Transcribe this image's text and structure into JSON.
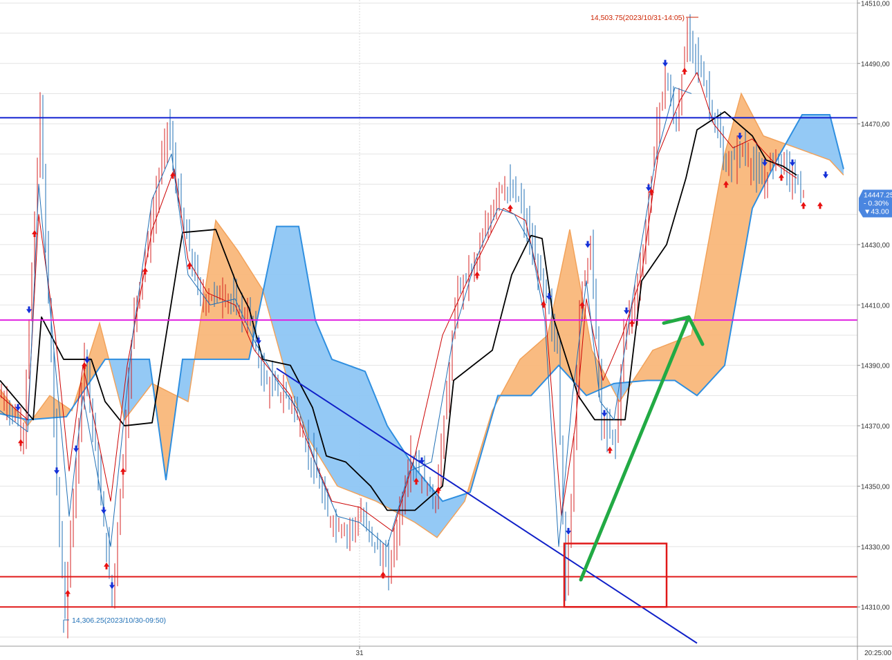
{
  "chart_data": {
    "type": "line",
    "title": "",
    "xlabel": "",
    "ylabel": "",
    "ylim": [
      14297,
      14511
    ],
    "y_ticks": [
      {
        "value": 14510,
        "label": "14510,00"
      },
      {
        "value": 14490,
        "label": "14490,00"
      },
      {
        "value": 14470,
        "label": "14470,00"
      },
      {
        "value": 14430,
        "label": "14430,00"
      },
      {
        "value": 14410,
        "label": "14410,00"
      },
      {
        "value": 14390,
        "label": "14390,00"
      },
      {
        "value": 14370,
        "label": "14370,00"
      },
      {
        "value": 14350,
        "label": "14350,00"
      },
      {
        "value": 14330,
        "label": "14330,00"
      },
      {
        "value": 14310,
        "label": "14310,00"
      }
    ],
    "y_ticks_minor": [
      14500,
      14480,
      14460,
      14450,
      14440,
      14420,
      14400,
      14380,
      14360,
      14340,
      14320,
      14300
    ],
    "x_labels": [
      {
        "index": 130,
        "label": "31"
      },
      {
        "index": 310,
        "label": "20:25:00"
      }
    ],
    "bar_count": 310,
    "price": {
      "keypoints": [
        [
          0,
          14380
        ],
        [
          8,
          14368
        ],
        [
          14,
          14474
        ],
        [
          20,
          14350
        ],
        [
          23,
          14307
        ],
        [
          30,
          14395
        ],
        [
          40,
          14312
        ],
        [
          48,
          14408
        ],
        [
          55,
          14440
        ],
        [
          60,
          14470
        ],
        [
          65,
          14440
        ],
        [
          72,
          14412
        ],
        [
          80,
          14414
        ],
        [
          90,
          14405
        ],
        [
          95,
          14385
        ],
        [
          105,
          14378
        ],
        [
          113,
          14356
        ],
        [
          118,
          14340
        ],
        [
          125,
          14335
        ],
        [
          130,
          14340
        ],
        [
          140,
          14322
        ],
        [
          148,
          14360
        ],
        [
          157,
          14345
        ],
        [
          165,
          14415
        ],
        [
          172,
          14425
        ],
        [
          180,
          14450
        ],
        [
          187,
          14445
        ],
        [
          193,
          14425
        ],
        [
          197,
          14412
        ],
        [
          201,
          14395
        ],
        [
          204,
          14315
        ],
        [
          206,
          14345
        ],
        [
          209,
          14410
        ],
        [
          213,
          14430
        ],
        [
          217,
          14370
        ],
        [
          222,
          14365
        ],
        [
          225,
          14400
        ],
        [
          230,
          14415
        ],
        [
          233,
          14435
        ],
        [
          237,
          14470
        ],
        [
          240,
          14485
        ],
        [
          244,
          14470
        ],
        [
          248,
          14500
        ],
        [
          252,
          14490
        ],
        [
          256,
          14478
        ],
        [
          262,
          14455
        ],
        [
          268,
          14462
        ],
        [
          275,
          14450
        ],
        [
          280,
          14460
        ],
        [
          286,
          14452
        ],
        [
          290,
          14448
        ]
      ],
      "end_index": 290
    },
    "series": [
      {
        "name": "",
        "role": "baseline",
        "color": "#000000",
        "keypoints": [
          [
            0,
            14385
          ],
          [
            12,
            14372
          ],
          [
            15,
            14406
          ],
          [
            23,
            14392
          ],
          [
            33,
            14392
          ],
          [
            38,
            14378
          ],
          [
            45,
            14370
          ],
          [
            55,
            14371
          ],
          [
            66,
            14434
          ],
          [
            78,
            14435
          ],
          [
            86,
            14416
          ],
          [
            90,
            14409
          ],
          [
            95,
            14392
          ],
          [
            105,
            14390
          ],
          [
            113,
            14376
          ],
          [
            118,
            14360
          ],
          [
            125,
            14358
          ],
          [
            134,
            14350
          ],
          [
            140,
            14342
          ],
          [
            150,
            14342
          ],
          [
            160,
            14350
          ],
          [
            164,
            14385
          ],
          [
            178,
            14395
          ],
          [
            185,
            14420
          ],
          [
            192,
            14433
          ],
          [
            196,
            14432
          ],
          [
            200,
            14406
          ],
          [
            209,
            14380
          ],
          [
            215,
            14372
          ],
          [
            226,
            14372
          ],
          [
            232,
            14418
          ],
          [
            241,
            14430
          ],
          [
            248,
            14452
          ],
          [
            252,
            14468
          ],
          [
            262,
            14474
          ],
          [
            267,
            14470
          ],
          [
            272,
            14466
          ],
          [
            277,
            14458
          ],
          [
            283,
            14456
          ],
          [
            288,
            14453
          ]
        ]
      },
      {
        "name": "",
        "role": "conversion",
        "color": "#cc0000",
        "keypoints": [
          [
            0,
            14380
          ],
          [
            10,
            14372
          ],
          [
            14,
            14440
          ],
          [
            20,
            14400
          ],
          [
            25,
            14355
          ],
          [
            30,
            14390
          ],
          [
            40,
            14345
          ],
          [
            46,
            14390
          ],
          [
            55,
            14435
          ],
          [
            63,
            14455
          ],
          [
            68,
            14425
          ],
          [
            75,
            14414
          ],
          [
            85,
            14410
          ],
          [
            92,
            14395
          ],
          [
            105,
            14380
          ],
          [
            113,
            14360
          ],
          [
            120,
            14345
          ],
          [
            130,
            14343
          ],
          [
            142,
            14335
          ],
          [
            150,
            14360
          ],
          [
            160,
            14400
          ],
          [
            170,
            14420
          ],
          [
            182,
            14442
          ],
          [
            190,
            14438
          ],
          [
            197,
            14410
          ],
          [
            203,
            14340
          ],
          [
            208,
            14370
          ],
          [
            212,
            14412
          ],
          [
            218,
            14385
          ],
          [
            225,
            14400
          ],
          [
            232,
            14420
          ],
          [
            238,
            14460
          ],
          [
            246,
            14478
          ],
          [
            252,
            14487
          ],
          [
            258,
            14470
          ],
          [
            265,
            14462
          ],
          [
            272,
            14465
          ],
          [
            280,
            14457
          ],
          [
            288,
            14452
          ]
        ]
      },
      {
        "name": "",
        "role": "lagging-span",
        "color": "#1f6fb5",
        "keypoints": [
          [
            0,
            14375
          ],
          [
            10,
            14368
          ],
          [
            14,
            14450
          ],
          [
            20,
            14390
          ],
          [
            25,
            14340
          ],
          [
            30,
            14380
          ],
          [
            40,
            14330
          ],
          [
            48,
            14400
          ],
          [
            55,
            14445
          ],
          [
            62,
            14460
          ],
          [
            68,
            14420
          ],
          [
            76,
            14410
          ],
          [
            85,
            14412
          ],
          [
            92,
            14398
          ],
          [
            100,
            14385
          ],
          [
            108,
            14375
          ],
          [
            115,
            14355
          ],
          [
            122,
            14340
          ],
          [
            130,
            14338
          ],
          [
            140,
            14330
          ],
          [
            148,
            14355
          ],
          [
            156,
            14358
          ],
          [
            164,
            14400
          ],
          [
            172,
            14425
          ],
          [
            180,
            14442
          ],
          [
            186,
            14440
          ],
          [
            192,
            14430
          ],
          [
            197,
            14405
          ],
          [
            202,
            14330
          ],
          [
            207,
            14380
          ],
          [
            212,
            14418
          ],
          [
            217,
            14378
          ],
          [
            222,
            14372
          ],
          [
            230,
            14420
          ],
          [
            237,
            14458
          ],
          [
            244,
            14482
          ],
          [
            250,
            14480
          ]
        ]
      }
    ],
    "cloud": {
      "color_bull": "#f9b77a",
      "color_bear": "#8ec6f4",
      "span_a": [
        [
          0,
          14382
        ],
        [
          10,
          14370
        ],
        [
          18,
          14380
        ],
        [
          26,
          14375
        ],
        [
          36,
          14404
        ],
        [
          45,
          14372
        ],
        [
          55,
          14384
        ],
        [
          68,
          14378
        ],
        [
          78,
          14438
        ],
        [
          86,
          14428
        ],
        [
          95,
          14415
        ],
        [
          104,
          14385
        ],
        [
          112,
          14365
        ],
        [
          122,
          14350
        ],
        [
          136,
          14345
        ],
        [
          150,
          14338
        ],
        [
          158,
          14333
        ],
        [
          168,
          14345
        ],
        [
          178,
          14375
        ],
        [
          188,
          14392
        ],
        [
          198,
          14400
        ],
        [
          206,
          14435
        ],
        [
          214,
          14395
        ],
        [
          224,
          14378
        ],
        [
          236,
          14395
        ],
        [
          250,
          14400
        ],
        [
          262,
          14460
        ],
        [
          268,
          14480
        ],
        [
          276,
          14466
        ],
        [
          288,
          14462
        ],
        [
          300,
          14458
        ],
        [
          305,
          14453
        ]
      ],
      "span_b": [
        [
          0,
          14374
        ],
        [
          10,
          14372
        ],
        [
          24,
          14373
        ],
        [
          38,
          14392
        ],
        [
          54,
          14392
        ],
        [
          60,
          14352
        ],
        [
          66,
          14392
        ],
        [
          78,
          14392
        ],
        [
          90,
          14392
        ],
        [
          100,
          14436
        ],
        [
          108,
          14436
        ],
        [
          114,
          14405
        ],
        [
          120,
          14392
        ],
        [
          132,
          14388
        ],
        [
          140,
          14370
        ],
        [
          150,
          14356
        ],
        [
          160,
          14345
        ],
        [
          170,
          14348
        ],
        [
          180,
          14380
        ],
        [
          192,
          14380
        ],
        [
          202,
          14390
        ],
        [
          212,
          14380
        ],
        [
          222,
          14384
        ],
        [
          234,
          14385
        ],
        [
          244,
          14385
        ],
        [
          252,
          14380
        ],
        [
          262,
          14390
        ],
        [
          272,
          14442
        ],
        [
          282,
          14460
        ],
        [
          290,
          14473
        ],
        [
          300,
          14473
        ],
        [
          305,
          14455
        ]
      ]
    },
    "signals": {
      "buy": [
        7,
        12,
        24,
        30,
        38,
        44,
        52,
        62,
        68,
        138,
        150,
        158,
        172,
        184,
        196,
        210,
        220,
        228,
        235,
        247,
        262,
        282,
        290,
        296
      ],
      "sell": [
        6,
        10,
        20,
        27,
        31,
        37,
        40,
        93,
        152,
        198,
        205,
        212,
        218,
        226,
        234,
        240,
        267,
        276,
        286,
        298
      ]
    },
    "levels": [
      {
        "role": "resistance",
        "value": 14472,
        "color": "#1020d0"
      },
      {
        "role": "pivot",
        "value": 14405,
        "color": "#e020e0"
      },
      {
        "role": "support-1",
        "value": 14320,
        "color": "#e01818"
      },
      {
        "role": "support-2",
        "value": 14310,
        "color": "#e01818"
      }
    ],
    "trendline": {
      "color": "#1020c8",
      "from": [
        100,
        14389
      ],
      "to": [
        252,
        14298
      ]
    },
    "arrow_path": {
      "color": "#22aa44",
      "points": [
        [
          210,
          14319
        ],
        [
          249,
          14406
        ],
        [
          240,
          14404
        ]
      ],
      "head": [
        [
          249,
          14406
        ],
        [
          254,
          14397
        ]
      ]
    },
    "highlight_box": {
      "color": "#e01818",
      "x1": 204,
      "x2": 241,
      "y_top": 14331,
      "y_bottom": 14310
    },
    "annotations": [
      {
        "text": "14,503.75(2023/10/31-14:05)",
        "index": 250,
        "value": 14508,
        "color": "#cc2200",
        "anchor": "end"
      },
      {
        "text": "14,306.25(2023/10/30-09:50)",
        "index": 23,
        "value": 14306,
        "color": "#1f6fb5",
        "anchor": "start"
      }
    ],
    "current": {
      "value": 14447.25,
      "label": "14447.25",
      "change": "- 0.30%",
      "points": "▼43.00",
      "color": "#4a86e0"
    }
  }
}
